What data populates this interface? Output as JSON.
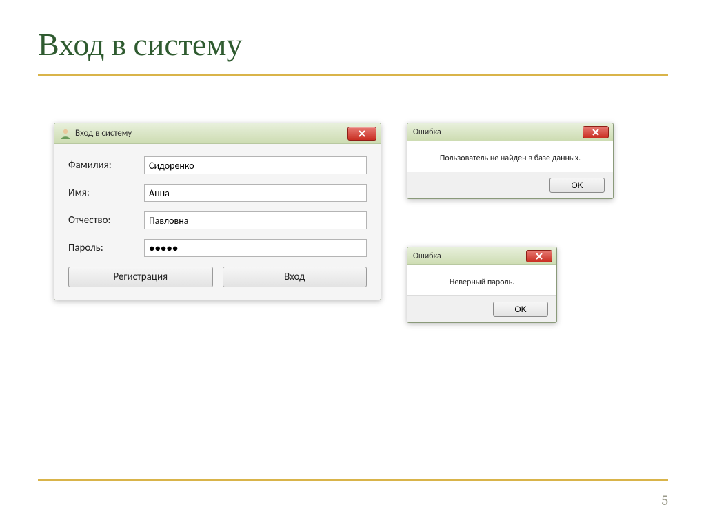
{
  "slide": {
    "title": "Вход в систему",
    "page_number": "5"
  },
  "login_dialog": {
    "title": "Вход в систему",
    "fields": {
      "surname_label": "Фамилия:",
      "surname_value": "Сидоренко",
      "name_label": "Имя:",
      "name_value": "Анна",
      "patronymic_label": "Отчество:",
      "patronymic_value": "Павловна",
      "password_label": "Пароль:",
      "password_value": "●●●●●"
    },
    "buttons": {
      "register": "Регистрация",
      "login": "Вход"
    }
  },
  "error1": {
    "title": "Ошибка",
    "message": "Пользователь не найден в базе данных.",
    "ok": "OK"
  },
  "error2": {
    "title": "Ошибка",
    "message": "Неверный пароль.",
    "ok": "OK"
  }
}
